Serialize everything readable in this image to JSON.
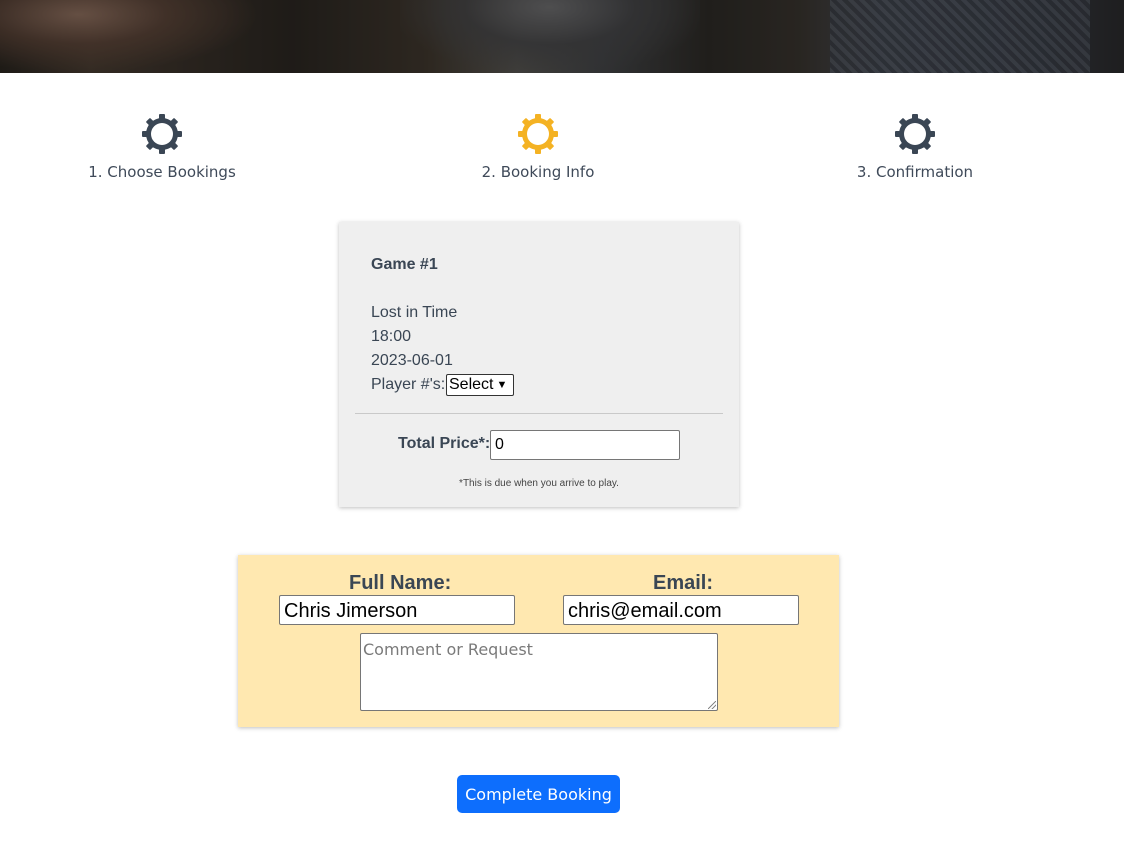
{
  "steps": [
    {
      "label": "1. Choose Bookings",
      "icon": "gear-icon",
      "color": "#3a4654"
    },
    {
      "label": "2. Booking Info",
      "icon": "gear-icon",
      "color": "#f4b223"
    },
    {
      "label": "3. Confirmation",
      "icon": "gear-icon",
      "color": "#3a4654"
    }
  ],
  "game": {
    "title": "Game #1",
    "name": "Lost in Time",
    "time": "18:00",
    "date": "2023-06-01",
    "players_label": "Player #'s:",
    "players_value": "Select",
    "price_label": "Total Price*:",
    "price_value": "0",
    "price_note": "*This is due when you arrive to play."
  },
  "contact": {
    "name_label": "Full Name:",
    "name_value": "Chris Jimerson",
    "email_label": "Email:",
    "email_value": "chris@email.com",
    "comment_placeholder": "Comment or Request"
  },
  "actions": {
    "complete_label": "Complete Booking"
  },
  "colors": {
    "active_step": "#f4b223",
    "inactive_step": "#3a4654",
    "contact_bg": "#ffe8b0",
    "button_bg": "#0d6efd"
  }
}
